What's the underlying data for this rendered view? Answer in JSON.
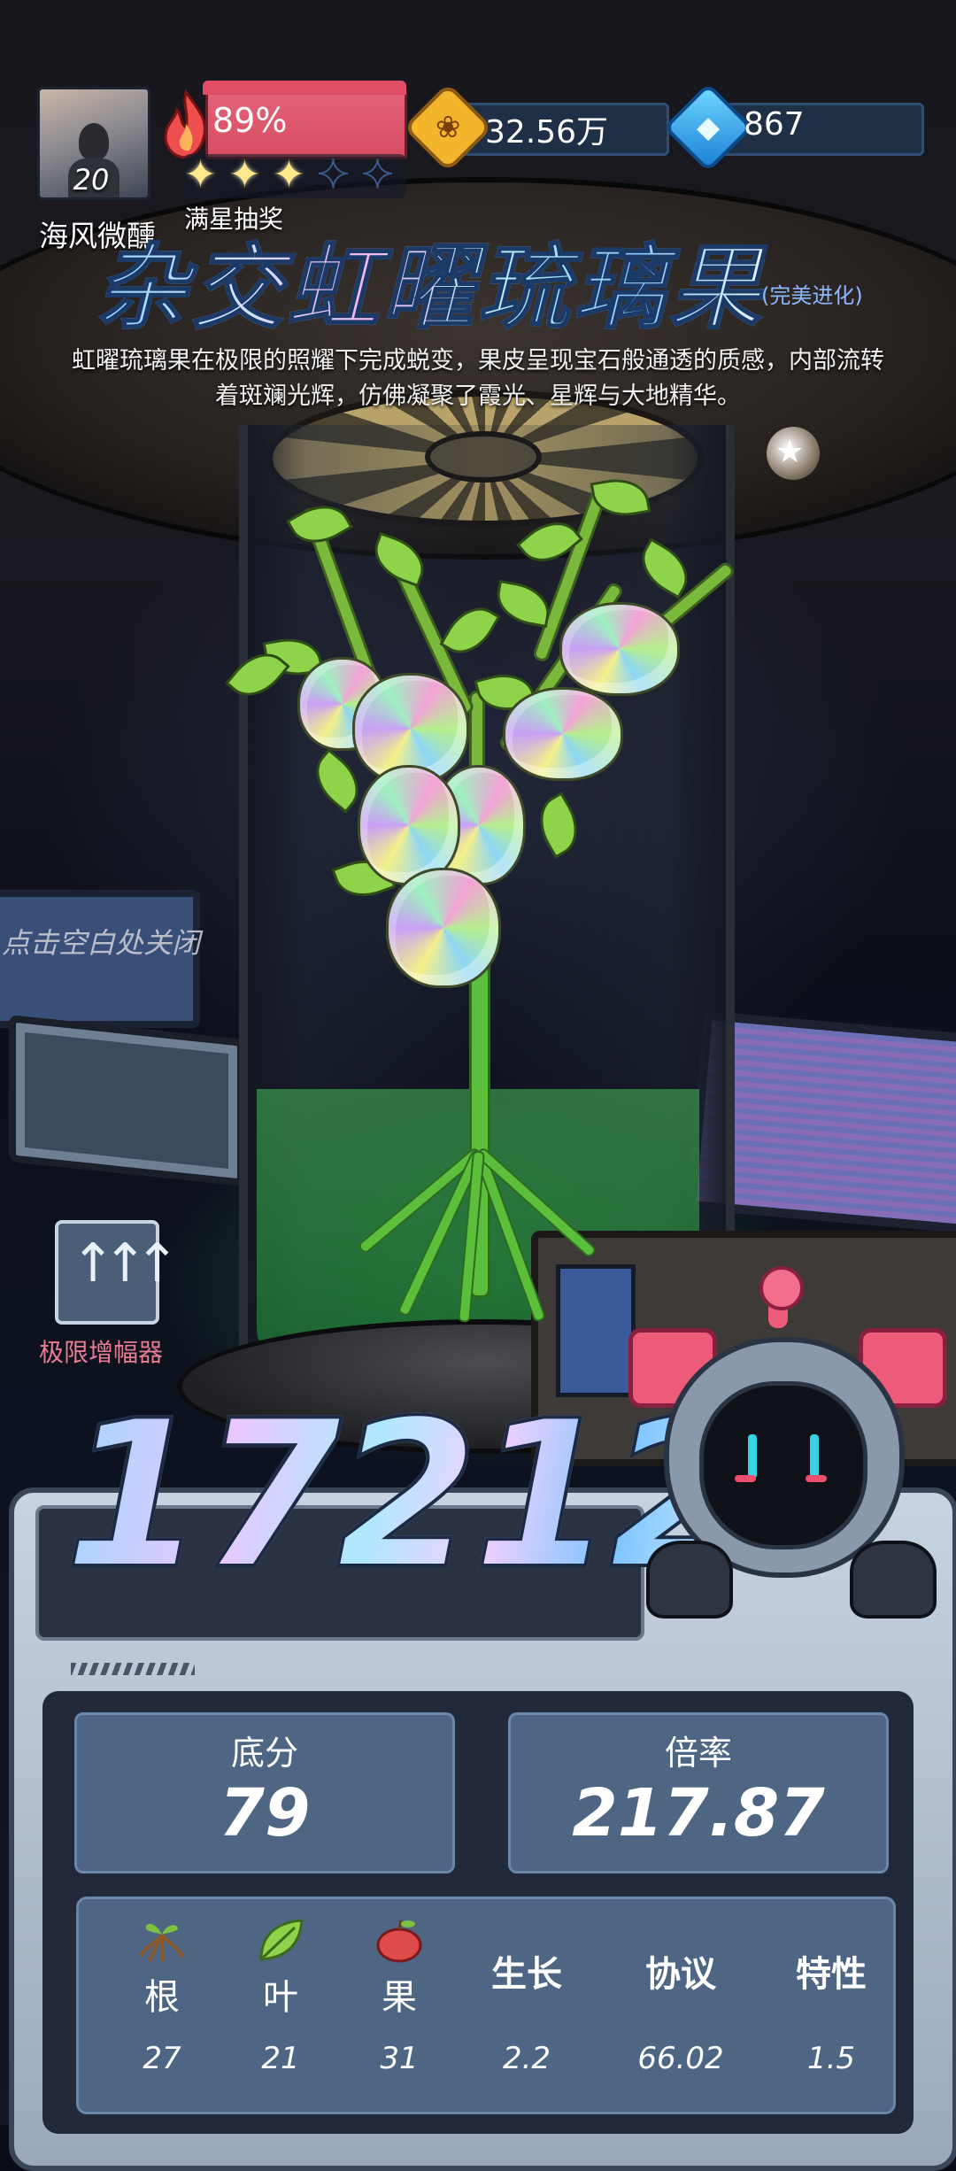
{
  "player": {
    "nickname": "海风微醺",
    "level": "20"
  },
  "heat": {
    "percent_text": "89%",
    "stars_filled": 3,
    "stars_total": 5,
    "stars_label": "满星抽奖"
  },
  "currency": {
    "coins": "32.56万",
    "gems": "867"
  },
  "item": {
    "title": "杂交虹曜琉璃果",
    "tag": "(完美进化)",
    "description": "虹曜琉璃果在极限的照耀下完成蜕变，果皮呈现宝石般通透的质感，内部流转着斑斓光辉，仿佛凝聚了霞光、星辉与大地精华。"
  },
  "hints": {
    "close": "点击空白处关闭"
  },
  "amplifier": {
    "label": "极限增幅器"
  },
  "score": {
    "total": "17212"
  },
  "stats": {
    "base": {
      "label": "底分",
      "value": "79"
    },
    "multiplier": {
      "label": "倍率",
      "value": "217.87"
    }
  },
  "attributes": [
    {
      "name": "根",
      "value": "27",
      "icon": "root-icon"
    },
    {
      "name": "叶",
      "value": "21",
      "icon": "leaf-icon"
    },
    {
      "name": "果",
      "value": "31",
      "icon": "apple-icon"
    },
    {
      "name": "生长",
      "value": "2.2"
    },
    {
      "name": "协议",
      "value": "66.02"
    },
    {
      "name": "特性",
      "value": "1.5"
    }
  ],
  "colors": {
    "accent_pink": "#e87c92",
    "panel_blue": "#4e6584",
    "heat_red": "#d64b62",
    "coin_gold": "#f2b52c",
    "gem_blue": "#1c7fd6"
  }
}
